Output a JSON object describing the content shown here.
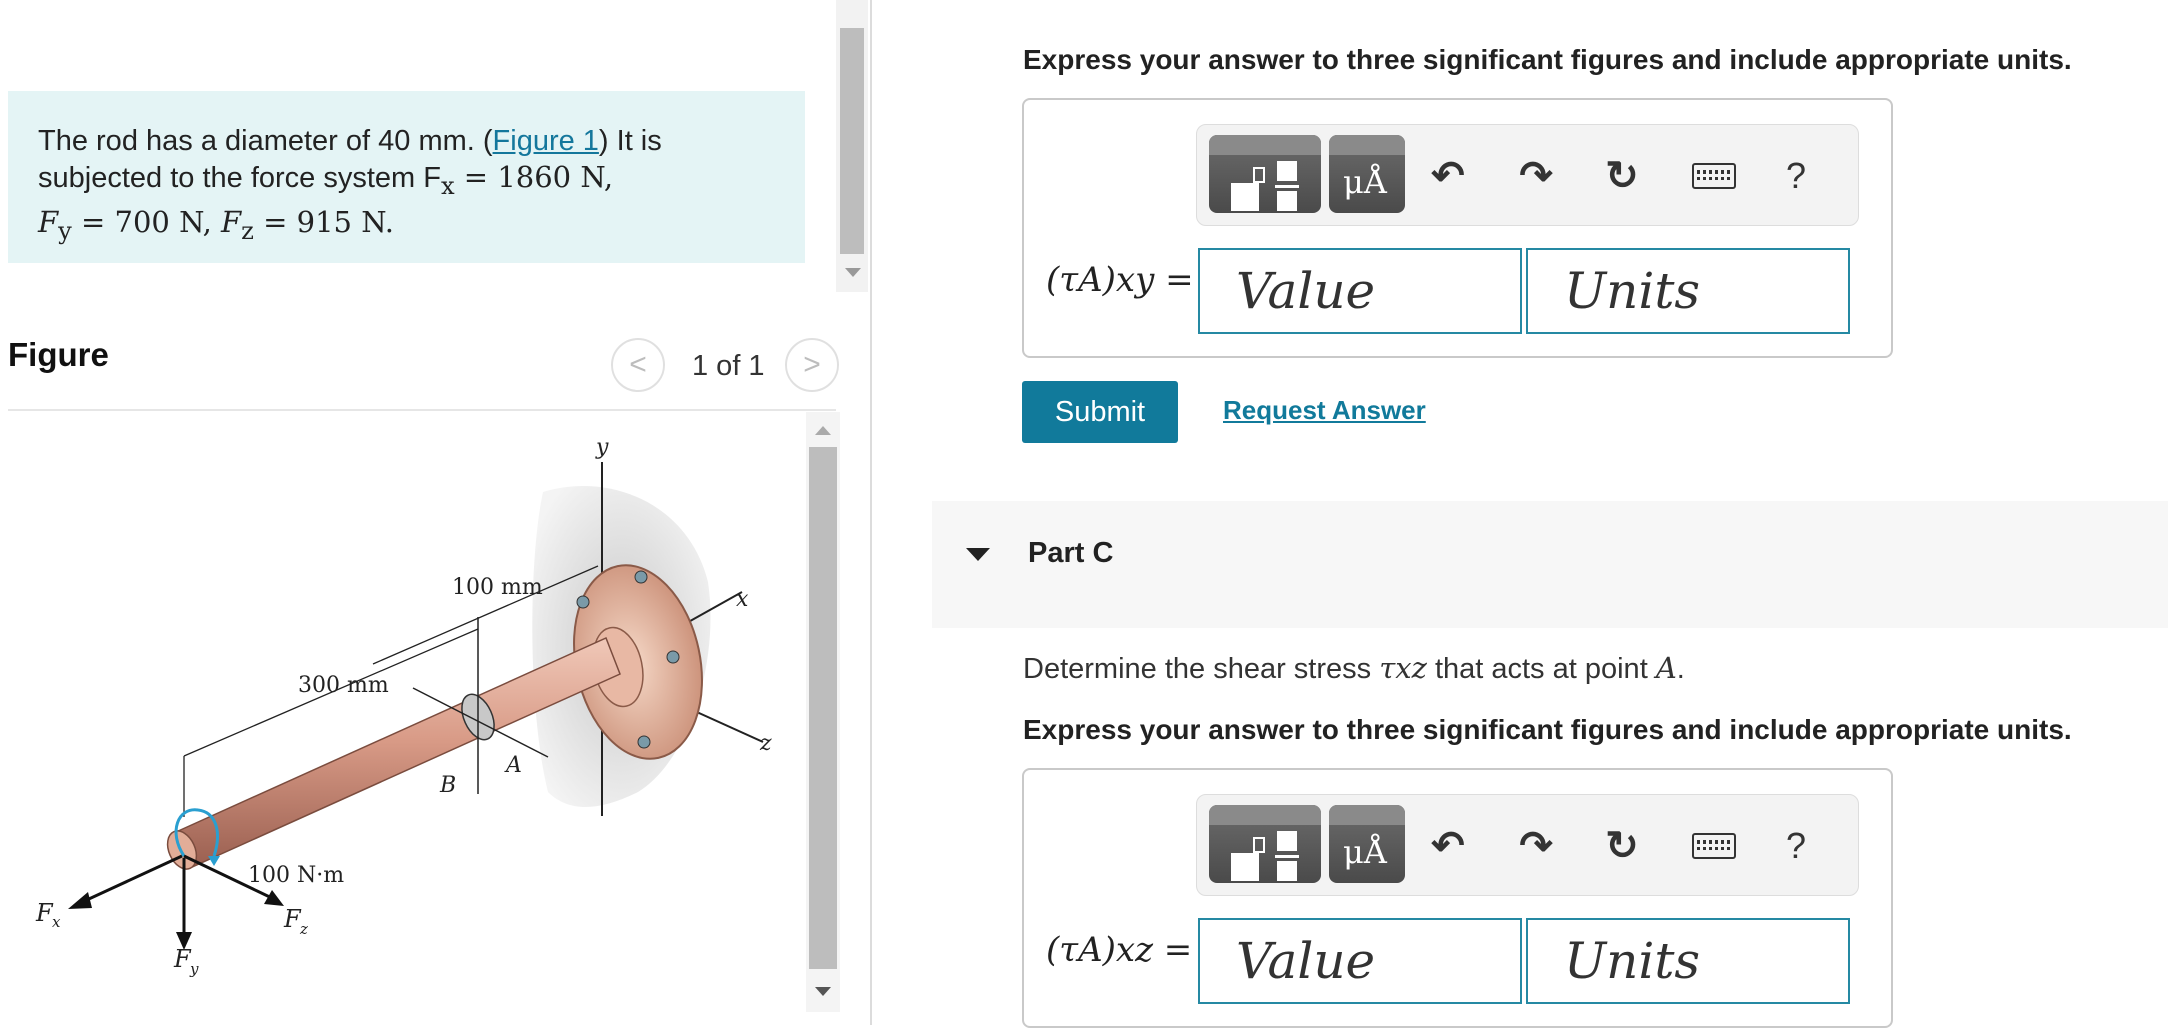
{
  "problem": {
    "text_before_link": "The rod has a diameter of 40 mm. (",
    "figure_link": "Figure 1",
    "text_after_link": ") It is subjected to the force system F",
    "sub_x": "x",
    "eq_x": " = 1860 N,",
    "fy_label": "F",
    "sub_y": "y",
    "eq_y": " = 700 N, ",
    "fz_label": "F",
    "sub_z": "z",
    "eq_z": " = 915 N."
  },
  "figure": {
    "heading": "Figure",
    "count": "1 of 1",
    "prev_glyph": "<",
    "next_glyph": ">",
    "labels": {
      "y": "y",
      "x": "x",
      "z": "z",
      "dim_100": "100 mm",
      "dim_300": "300 mm",
      "torque": "100 N·m",
      "point_b": "B",
      "point_a": "A",
      "fx": "F",
      "fx_sub": "x",
      "fy": "F",
      "fy_sub": "y",
      "fz": "F",
      "fz_sub": "z"
    }
  },
  "part_b": {
    "instruction": "Express your answer to three significant figures and include appropriate units.",
    "eq_label": "(τA)xy =",
    "value_placeholder": "Value",
    "units_placeholder": "Units"
  },
  "toolbar": {
    "units_tile": "μÅ",
    "undo": "↶",
    "redo": "↷",
    "reset": "↻",
    "help": "?"
  },
  "actions": {
    "submit": "Submit",
    "request_answer": "Request Answer"
  },
  "part_c": {
    "title": "Part C",
    "question_before": "Determine the shear stress ",
    "question_symbol": "τxz",
    "question_after": " that acts at point ",
    "question_point": "A",
    "question_end": ".",
    "instruction": "Express your answer to three significant figures and include appropriate units.",
    "eq_label": "(τA)xz =",
    "value_placeholder": "Value",
    "units_placeholder": "Units"
  },
  "colors": {
    "accent": "#117a9b",
    "problem_bg": "#e4f4f5",
    "input_border": "#2589a3"
  }
}
